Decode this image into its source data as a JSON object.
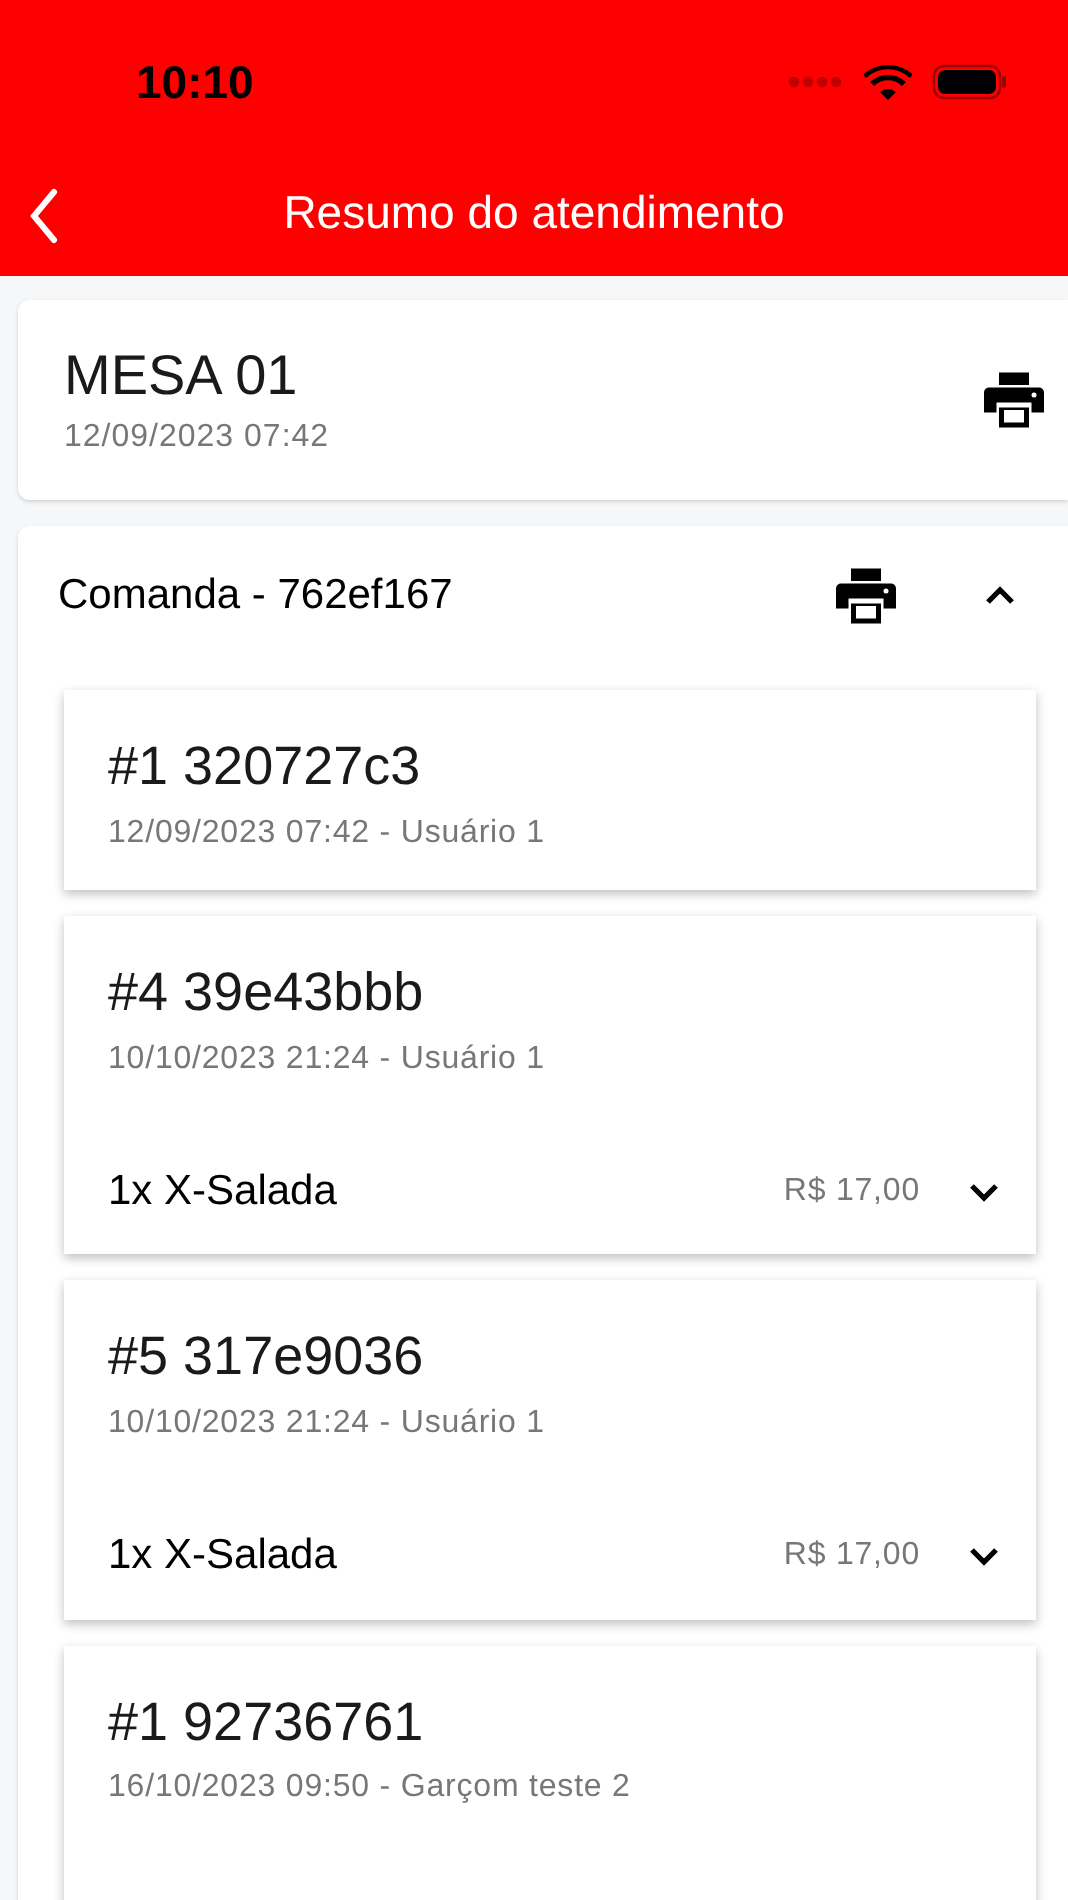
{
  "status_bar": {
    "time": "10:10"
  },
  "header": {
    "title": "Resumo do atendimento"
  },
  "table": {
    "name": "MESA 01",
    "datetime": "12/09/2023 07:42"
  },
  "comanda": {
    "title": "Comanda - 762ef167",
    "expanded": true,
    "orders": [
      {
        "title": "#1 320727c3",
        "meta": "12/09/2023 07:42 - Usuário 1"
      },
      {
        "title": "#4 39e43bbb",
        "meta": "10/10/2023 21:24 - Usuário 1",
        "items": [
          {
            "label": "1x X-Salada",
            "price": "R$ 17,00",
            "expanded": false
          }
        ]
      },
      {
        "title": "#5 317e9036",
        "meta": "10/10/2023 21:24 - Usuário 1",
        "items": [
          {
            "label": "1x X-Salada",
            "price": "R$ 17,00",
            "expanded": false
          }
        ]
      },
      {
        "title": "#1 92736761",
        "meta": "16/10/2023 09:50 - Garçom teste 2"
      }
    ]
  }
}
